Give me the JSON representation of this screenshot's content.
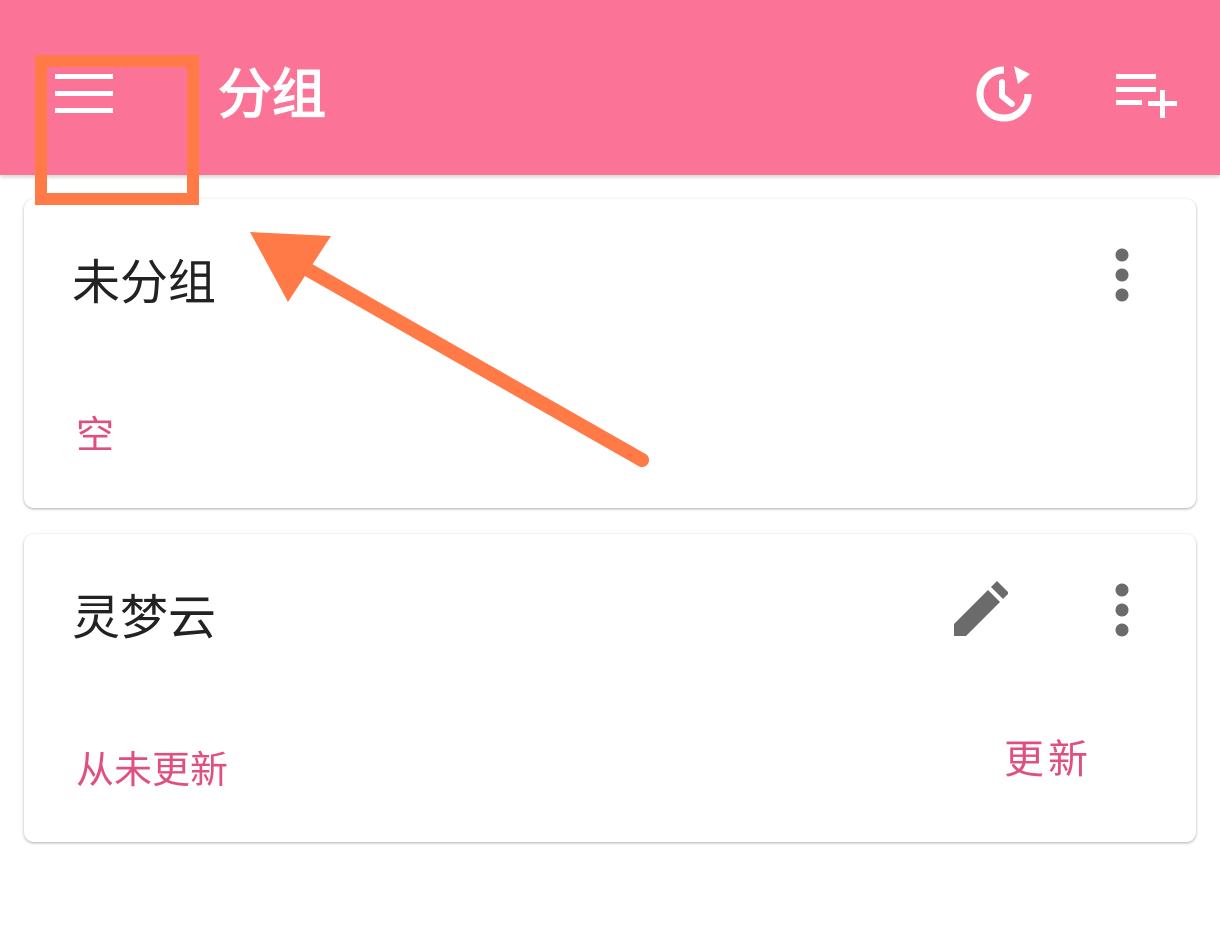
{
  "appbar": {
    "title": "分组",
    "background_color": "#fb7497",
    "menu_icon": "menu-icon",
    "history_icon": "history-refresh-icon",
    "add_list_icon": "playlist-add-icon"
  },
  "groups": [
    {
      "name": "未分组",
      "status": "空",
      "more_icon": "more-vert-icon"
    },
    {
      "name": "灵梦云",
      "status": "从未更新",
      "update_label": "更新",
      "edit_icon": "edit-pencil-icon",
      "more_icon": "more-vert-icon"
    }
  ],
  "colors": {
    "accent": "#e0507f",
    "annotation": "#ff7a47",
    "icon_gray": "#6b6b6b"
  }
}
